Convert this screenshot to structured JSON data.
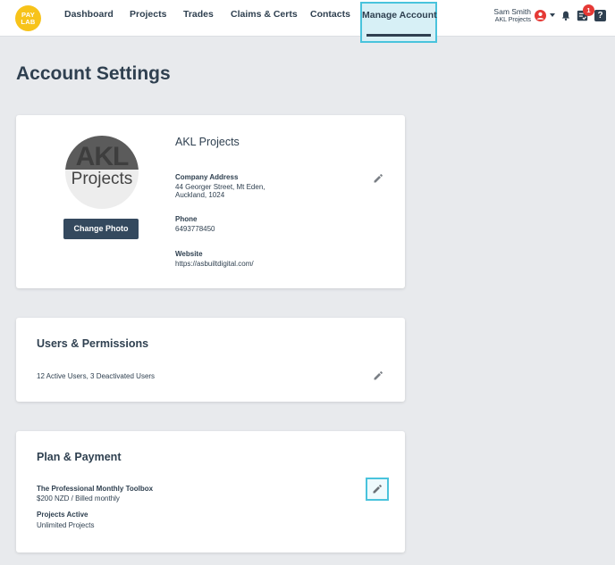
{
  "nav": {
    "logo_line1": "PAY",
    "logo_line2": "LAB",
    "items": [
      "Dashboard",
      "Projects",
      "Trades",
      "Claims & Certs",
      "Contacts"
    ],
    "active": "Manage Account"
  },
  "user": {
    "name": "Sam Smith",
    "company": "AKL Projects",
    "notification_count": "1",
    "help_label": "?"
  },
  "page": {
    "title": "Account Settings"
  },
  "account": {
    "avatar_text_top": "AKL",
    "avatar_text_bottom": "Projects",
    "change_photo_label": "Change Photo",
    "company_name": "AKL Projects",
    "address_label": "Company Address",
    "address_line1": "44 Georger Street, Mt Eden,",
    "address_line2": "Auckland, 1024",
    "phone_label": "Phone",
    "phone_value": "6493778450",
    "website_label": "Website",
    "website_value": "https://asbuiltdigital.com/"
  },
  "users": {
    "title": "Users & Permissions",
    "summary": "12 Active Users, 3 Deactivated Users"
  },
  "plan": {
    "title": "Plan & Payment",
    "plan_name": "The Professional Monthly Toolbox",
    "plan_price": "$200 NZD / Billed monthly",
    "projects_label": "Projects Active",
    "projects_value": "Unlimited Projects"
  },
  "icons": {
    "edit": "pencil-icon",
    "user": "user-circle-icon",
    "bell": "bell-icon",
    "tasks": "tasks-icon",
    "help": "help-icon"
  },
  "colors": {
    "accent_highlight": "#49c3dc",
    "logo_yellow": "#f7c31a",
    "button_dark": "#34495e",
    "user_red": "#e53935"
  }
}
